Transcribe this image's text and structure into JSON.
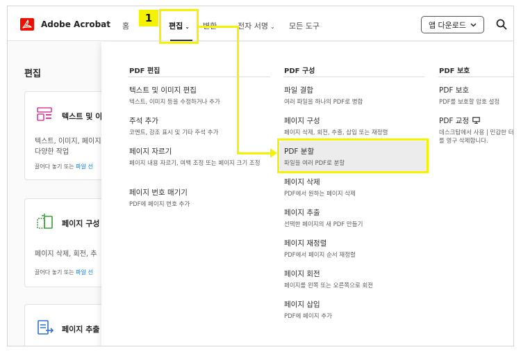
{
  "header": {
    "brand": "Adobe Acrobat",
    "nav": [
      {
        "label": "홈"
      },
      {
        "label": "편집"
      },
      {
        "label": "변환"
      },
      {
        "label": "전자 서명"
      },
      {
        "label": "모든 도구"
      }
    ],
    "app_download": "앱 다운로드",
    "search_icon": "search-icon",
    "logo_icon": "adobe-logo-icon"
  },
  "callout": {
    "number": "1"
  },
  "page": {
    "title": "편집",
    "cards": [
      {
        "title": "텍스트 및 이",
        "desc1": "텍스트, 이미지, 페이지",
        "desc2": "다양한 작업",
        "hint": "끌어다 놓기 또는 ",
        "hint_link": "파일 선"
      },
      {
        "title": "페이지 구성",
        "desc1": "페이지 삭제, 회전, 추",
        "hint": "끌어다 놓기 또는 ",
        "hint_link": "파일 선"
      },
      {
        "title": "페이지 추출"
      }
    ]
  },
  "menu": {
    "columns": [
      {
        "heading": "PDF 편집",
        "items": [
          {
            "title": "텍스트 및 이미지 편집",
            "desc": "텍스트, 이미지 등을 수정하거나 추가"
          },
          {
            "title": "주석 추가",
            "desc": "코멘트, 강조 표시 및 기타 주석 추가"
          },
          {
            "title": "페이지 자르기",
            "desc": "페이지 내용 자르기, 여백 조정 또는 페이지 크기 조정"
          },
          {
            "title": "페이지 번호 매기기",
            "desc": "PDF에 페이지 번호 추가"
          }
        ]
      },
      {
        "heading": "PDF 구성",
        "items": [
          {
            "title": "파일 결합",
            "desc": "여러 파일을 하나의 PDF로 병합"
          },
          {
            "title": "페이지 구성",
            "desc": "페이지 삭제, 회전, 추출, 삽입 또는 재정렬"
          },
          {
            "title": "PDF 분할",
            "desc": "파일을 여러 PDF로 분할"
          },
          {
            "title": "페이지 삭제",
            "desc": "PDF에서 원하는 페이지 삭제"
          },
          {
            "title": "페이지 추출",
            "desc": "선택한 페이지의 새 PDF 만들기"
          },
          {
            "title": "페이지 재정렬",
            "desc": "PDF에서 페이지 순서 재정렬"
          },
          {
            "title": "페이지 회전",
            "desc": "페이지를 왼쪽 또는 오른쪽으로 회전"
          },
          {
            "title": "페이지 삽입",
            "desc": "PDF에 페이지 추가"
          }
        ]
      },
      {
        "heading": "PDF 보호",
        "items": [
          {
            "title": "PDF 보호",
            "desc": "PDF를 보호할 암호 설정"
          },
          {
            "title": "PDF 교정",
            "desc": "데스크탑에서 사용 | 민감한 터를 영구 삭제합니다."
          }
        ]
      }
    ]
  },
  "colors": {
    "highlight": "#f5f200",
    "adobe_red": "#eb1000",
    "link": "#1473e6"
  }
}
